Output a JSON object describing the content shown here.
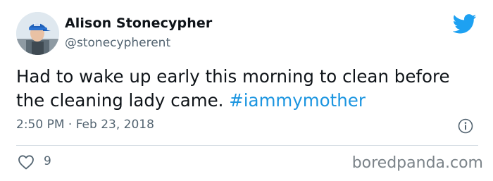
{
  "author": {
    "name": "Alison Stonecypher",
    "handle": "@stonecypherent"
  },
  "tweet": {
    "text": "Had to wake up early this morning to clean before the cleaning lady came. ",
    "hashtag": "#iammymother",
    "meta": "2:50 PM · Feb 23, 2018"
  },
  "engagement": {
    "likes": "9"
  },
  "watermark": "boredpanda.com",
  "icons": {
    "brand": "twitter-bird-icon",
    "info": "info-icon",
    "like": "heart-icon"
  },
  "colors": {
    "twitter_blue": "#1da1f2",
    "hashtag": "#1b95e0",
    "secondary_text": "#536471",
    "divider": "#d5dde3"
  }
}
